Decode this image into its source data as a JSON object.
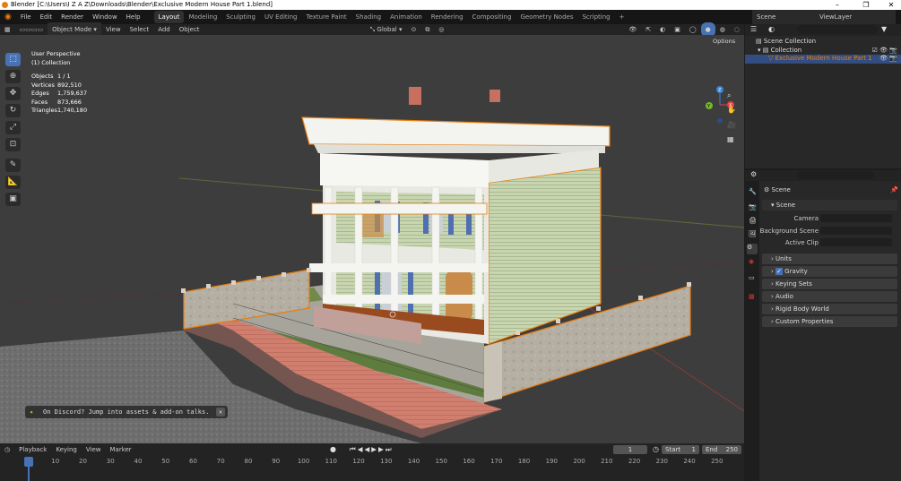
{
  "title": "Blender [C:\\Users\\I Z A Z\\Downloads\\Blender\\Exclusive Modern House Part 1.blend]",
  "menus": [
    "File",
    "Edit",
    "Render",
    "Window",
    "Help"
  ],
  "workspaces": [
    "Layout",
    "Modeling",
    "Sculpting",
    "UV Editing",
    "Texture Paint",
    "Shading",
    "Animation",
    "Rendering",
    "Compositing",
    "Geometry Nodes",
    "Scripting",
    "+"
  ],
  "scene_name": "Scene",
  "view_layer": "ViewLayer",
  "viewport_header": {
    "mode": "Object Mode",
    "menus": [
      "View",
      "Select",
      "Add",
      "Object"
    ],
    "orientation": "Global",
    "options": "Options"
  },
  "overlay": {
    "view_name": "User Perspective",
    "collection": "(1) Collection",
    "stats": [
      {
        "label": "Objects",
        "value": "1 / 1"
      },
      {
        "label": "Vertices",
        "value": "892,510"
      },
      {
        "label": "Edges",
        "value": "1,759,637"
      },
      {
        "label": "Faces",
        "value": "873,666"
      },
      {
        "label": "Triangles",
        "value": "1,740,180"
      }
    ]
  },
  "gizmo_axes": {
    "x": "X",
    "y": "Y",
    "z": "Z"
  },
  "outliner": {
    "scene_collection": "Scene Collection",
    "collection": "Collection",
    "object": "Exclusive Modern House Part 1"
  },
  "properties": {
    "context": "Scene",
    "section": "Scene",
    "fields": [
      {
        "label": "Camera",
        "value": ""
      },
      {
        "label": "Background Scene",
        "value": ""
      },
      {
        "label": "Active Clip",
        "value": ""
      }
    ],
    "panels": [
      "Units",
      "Gravity",
      "Keying Sets",
      "Audio",
      "Rigid Body World",
      "Custom Properties"
    ],
    "gravity_checked": true
  },
  "timeline": {
    "menus": [
      "Playback",
      "Keying",
      "View",
      "Marker"
    ],
    "current_frame": "1",
    "start_label": "Start",
    "start": "1",
    "end_label": "End",
    "end": "250",
    "ruler": [
      "1",
      "10",
      "20",
      "30",
      "40",
      "50",
      "60",
      "70",
      "80",
      "90",
      "100",
      "110",
      "120",
      "130",
      "140",
      "150",
      "160",
      "170",
      "180",
      "190",
      "200",
      "210",
      "220",
      "230",
      "240",
      "250"
    ]
  },
  "notice": "On Discord? Jump into assets & add-on talks.",
  "colors": {
    "accent": "#4772b3",
    "selection": "#e87d0d",
    "x_axis": "#e2404a",
    "y_axis": "#72b82c",
    "z_axis": "#3b82d6"
  }
}
